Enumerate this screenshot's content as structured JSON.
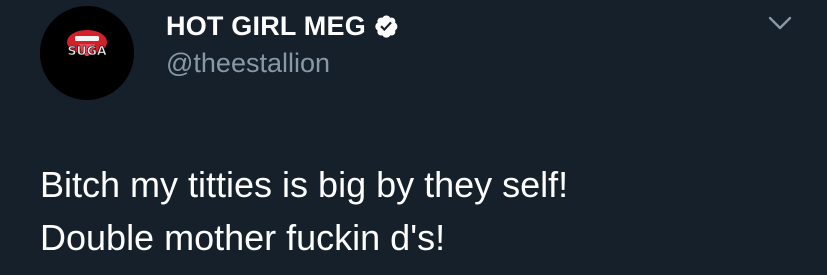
{
  "author": {
    "display_name": "HOT GIRL MEG",
    "handle": "@theestallion",
    "verified": true,
    "avatar_text": "SUGA",
    "avatar_icon": "open-mouth-with-tongue"
  },
  "tweet": {
    "lines": [
      "Bitch my titties is big by they self!",
      "Double mother fuckin d's!"
    ]
  },
  "menu": {
    "icon": "chevron-down-icon"
  },
  "colors": {
    "background": "#15202b",
    "text": "#ffffff",
    "secondary_text": "#8899a6",
    "avatar_accent": "#d2212a"
  }
}
